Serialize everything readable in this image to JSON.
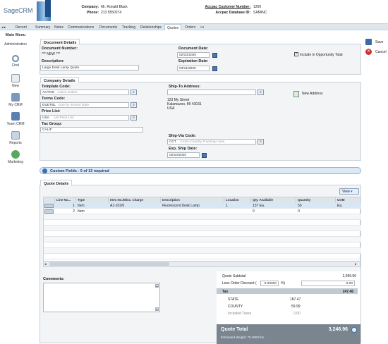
{
  "app": {
    "logo": "SageCRM"
  },
  "header": {
    "company_label": "Company:",
    "company_value": "Mr. Ronald Black",
    "phone_label": "Phone:",
    "phone_value": "213 5550274",
    "accpac_cust_label": "Accpac Customer Number:",
    "accpac_cust_value": "1200",
    "accpac_db_label": "Accpac Database ID:",
    "accpac_db_value": "SAMINC"
  },
  "tabs": [
    "Recent",
    "Summary",
    "Notes",
    "Communications",
    "Documents",
    "Tracking",
    "Relationships",
    "Quotes",
    "Orders",
    "•••"
  ],
  "sidebar": {
    "title": "Main Menu",
    "items": [
      "Administration",
      "Find",
      "New",
      "My CRM",
      "Team CRM",
      "Reports",
      "Marketing"
    ]
  },
  "actions": {
    "save": "Save",
    "cancel": "Cancel"
  },
  "doc": {
    "section": "Document Details",
    "number_label": "Document Number:",
    "number_value": "*** NEW ***",
    "desc_label": "Description:",
    "desc_value": "Large Desk Lamp Quote",
    "date_label": "Document Date:",
    "date_value": "02/10/2020",
    "exp_label": "Expiration Date:",
    "exp_value": "03/11/2020",
    "opp_label": "Include in Opportunity Total"
  },
  "company": {
    "section": "Company Details",
    "template_label": "Template Code:",
    "template_value": "ACTIVE",
    "template_ph": "Active orders",
    "terms_label": "Terms Code:",
    "terms_value": "DUETBL",
    "terms_ph": "Due by Invoice Date",
    "price_label": "Price List:",
    "price_value": "USA",
    "price_ph": "US Price List",
    "tax_label": "Tax Group:",
    "tax_value": "CALIF",
    "shipto_label": "Ship-To Address:",
    "addr1": "123 My Street",
    "addr2": "Kalamazoo, MI 43031",
    "addr3": "USA",
    "new_address": "New Address",
    "shipvia_label": "Ship-Via Code:",
    "shipvia_value": "CCT",
    "shipvia_ph": "Cross-Country Trucking Lines",
    "expship_label": "Exp. Ship Date:",
    "expship_value": "02/10/2020"
  },
  "custom": {
    "title": "Custom Fields - 0 of 13 required"
  },
  "quote": {
    "section": "Quote Details",
    "view": "View",
    "headers": [
      "Line Nu...",
      "Type",
      "Item No./Misc. Charge",
      "Description",
      "Location",
      "Qty. Available",
      "Quantity",
      "UOM"
    ],
    "rows": [
      [
        "1",
        "Item",
        "A1-103/0",
        "Fluorescent Desk Lamp",
        "1",
        "137 Ea.",
        "50",
        "Ea."
      ],
      [
        "2",
        "Item",
        "",
        "",
        "",
        "0",
        "0",
        ""
      ]
    ]
  },
  "comments": {
    "label": "Comments:"
  },
  "totals": {
    "subtotal_label": "Quote Subtotal",
    "subtotal": "2,999.50",
    "discount_label": "Less Order Discount (",
    "discount_pct": "0.00000",
    "pct": "%)",
    "discount": "0.00",
    "tax_label": "Tax",
    "tax": "247.46",
    "state_label": "STATE",
    "state": "187.47",
    "county_label": "COUNTY",
    "county": "59.99",
    "incl_label": "Included Taxes",
    "incl": "0.00",
    "total_label": "Quote Total",
    "total": "3,246.96",
    "weight": "Estimated Weight:  75.0000 lbs."
  }
}
